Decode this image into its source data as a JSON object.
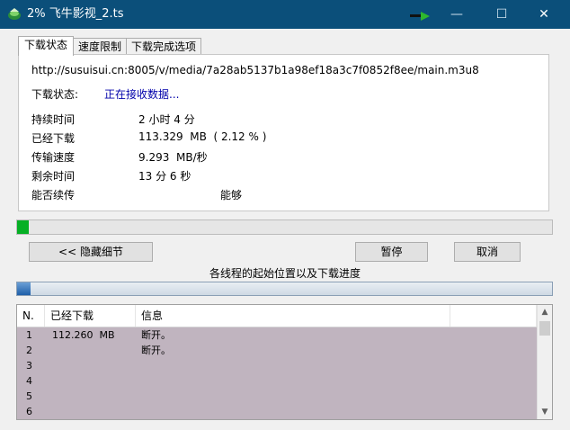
{
  "window": {
    "title": "2% 飞牛影视_2.ts",
    "minimize_glyph": "—",
    "maximize_glyph": "☐",
    "close_glyph": "✕"
  },
  "tabs": [
    "下载状态",
    "速度限制",
    "下载完成选项"
  ],
  "status": {
    "url": "http://susuisui.cn:8005/v/media/7a28ab5137b1a98ef18a3c7f0852f8ee/main.m3u8",
    "status_label": "下载状态:",
    "status_value": "正在接收数据...",
    "duration_label": "持续时间",
    "duration_value": "2 小时 4 分",
    "downloaded_label": "已经下载",
    "downloaded_value": "113.329  MB  ( 2.12 % )",
    "speed_label": "传输速度",
    "speed_value": "9.293  MB/秒",
    "remaining_label": "剩余时间",
    "remaining_value": "13 分 6 秒",
    "resume_label": "能否续传",
    "resume_value": "能够"
  },
  "progress": {
    "percent": 2.12
  },
  "buttons": {
    "hide_details": "<< 隐藏细节",
    "pause": "暂停",
    "cancel": "取消"
  },
  "threads": {
    "caption": "各线程的起始位置以及下载进度",
    "bar_fraction": 0.025,
    "columns": [
      "N.",
      "已经下载",
      "信息"
    ],
    "rows": [
      {
        "n": "1",
        "downloaded": "112.260  MB",
        "info": "断开。"
      },
      {
        "n": "2",
        "downloaded": "",
        "info": "断开。"
      },
      {
        "n": "3",
        "downloaded": "",
        "info": ""
      },
      {
        "n": "4",
        "downloaded": "",
        "info": ""
      },
      {
        "n": "5",
        "downloaded": "",
        "info": ""
      },
      {
        "n": "6",
        "downloaded": "",
        "info": ""
      }
    ]
  },
  "colors": {
    "titlebar": "#0b4f7a",
    "progress_fill": "#06b025",
    "list_bg": "#c0b4bf"
  },
  "icons": {
    "app": "idm-app-icon",
    "grip": "drag-grip-icon",
    "scroll_up": "scroll-up-icon",
    "scroll_down": "scroll-down-icon"
  }
}
